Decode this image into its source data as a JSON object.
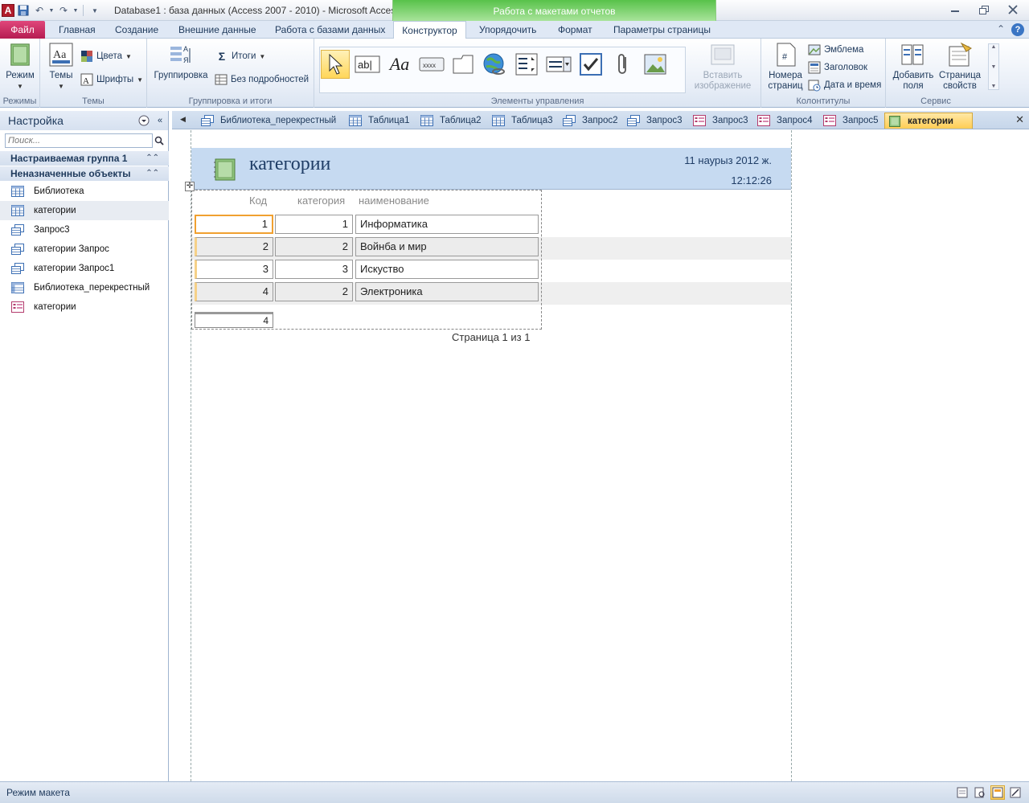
{
  "titlebar": {
    "title": "Database1 : база данных (Access 2007 - 2010)  -  Microsoft Access",
    "context_title": "Работа с макетами отчетов",
    "app_letter": "A"
  },
  "ribbon_tabs": {
    "file": "Файл",
    "home": "Главная",
    "create": "Создание",
    "external": "Внешние данные",
    "database": "Работа с базами данных",
    "design": "Конструктор",
    "arrange": "Упорядочить",
    "format": "Формат",
    "page_setup": "Параметры страницы"
  },
  "ribbon": {
    "views": {
      "mode": "Режим",
      "label": "Режимы"
    },
    "themes": {
      "themes": "Темы",
      "colors": "Цвета",
      "fonts": "Шрифты",
      "label": "Темы"
    },
    "grouping": {
      "group": "Группировка",
      "totals": "Итоги",
      "hide_details": "Без подробностей",
      "label": "Группировка и итоги"
    },
    "controls": {
      "insert_image_1": "Вставить",
      "insert_image_2": "изображение",
      "label": "Элементы управления",
      "textbox_glyph": "ab|",
      "label_glyph": "Aa",
      "button_glyph": "xxxx"
    },
    "header_footer": {
      "page_numbers_1": "Номера",
      "page_numbers_2": "страниц",
      "logo": "Эмблема",
      "title": "Заголовок",
      "date_time": "Дата и время",
      "label": "Колонтитулы",
      "hash": "#"
    },
    "tools": {
      "add_fields_1": "Добавить",
      "add_fields_2": "поля",
      "property_sheet_1": "Страница",
      "property_sheet_2": "свойств",
      "label": "Сервис"
    }
  },
  "nav": {
    "title": "Настройка",
    "search_placeholder": "Поиск...",
    "group1": "Настраиваемая группа 1",
    "group2": "Неназначенные объекты",
    "items": [
      {
        "label": "Библиотека",
        "type": "table"
      },
      {
        "label": "категории",
        "type": "table"
      },
      {
        "label": "Запрос3",
        "type": "query"
      },
      {
        "label": "категории Запрос",
        "type": "query"
      },
      {
        "label": "категории Запрос1",
        "type": "query"
      },
      {
        "label": "Библиотека_перекрестный",
        "type": "crosstab"
      },
      {
        "label": "категории",
        "type": "form"
      }
    ]
  },
  "doc_tabs": [
    {
      "label": "Библиотека_перекрестный",
      "type": "query"
    },
    {
      "label": "Таблица1",
      "type": "table"
    },
    {
      "label": "Таблица2",
      "type": "table"
    },
    {
      "label": "Таблица3",
      "type": "table"
    },
    {
      "label": "Запрос2",
      "type": "query"
    },
    {
      "label": "Запрос3",
      "type": "query"
    },
    {
      "label": "Запрос3",
      "type": "form"
    },
    {
      "label": "Запрос4",
      "type": "form"
    },
    {
      "label": "Запрос5",
      "type": "form"
    },
    {
      "label": "категории",
      "type": "report"
    }
  ],
  "report": {
    "title": "категории",
    "date": "11 наурыз 2012 ж.",
    "time": "12:12:26",
    "columns": [
      "Код",
      "категория",
      "наименование"
    ],
    "rows": [
      {
        "code": "1",
        "category": "1",
        "name": "Информатика"
      },
      {
        "code": "2",
        "category": "2",
        "name": "Войнба и мир"
      },
      {
        "code": "3",
        "category": "3",
        "name": "Искуство"
      },
      {
        "code": "4",
        "category": "2",
        "name": "Электроника"
      }
    ],
    "total": "4",
    "page": "Страница 1 из 1",
    "move_glyph": "✛"
  },
  "status": {
    "text": "Режим макета"
  },
  "colors": {
    "accent": "#b51c51",
    "context": "#58c24a",
    "header_band": "#c6daf1",
    "focus": "#f0a030"
  }
}
